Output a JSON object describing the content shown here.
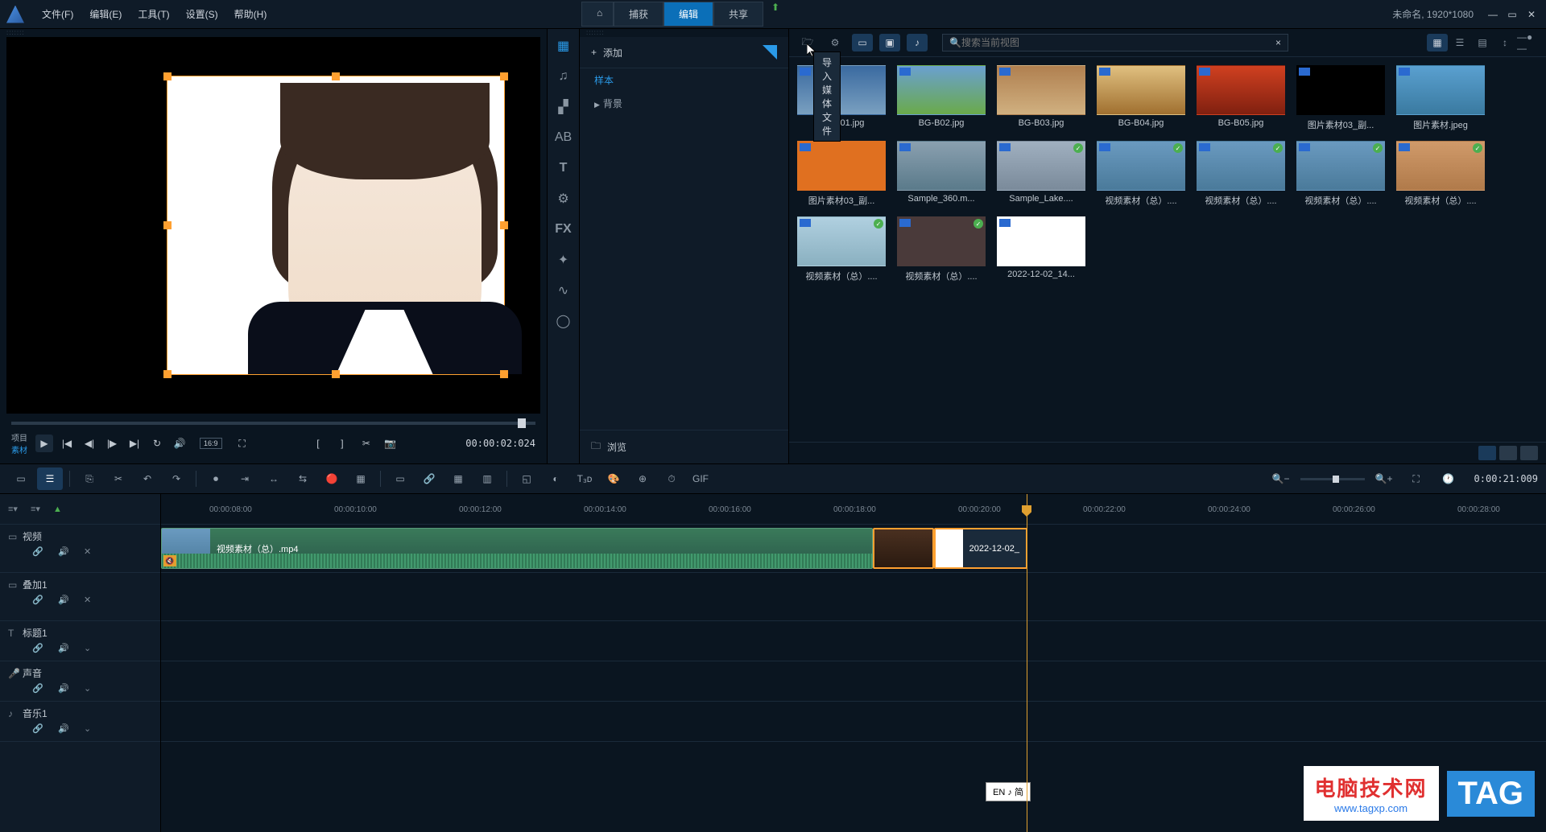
{
  "menu": {
    "file": "文件(F)",
    "edit": "编辑(E)",
    "tools": "工具(T)",
    "settings": "设置(S)",
    "help": "帮助(H)"
  },
  "modes": {
    "home": "⌂",
    "capture": "捕获",
    "edit": "编辑",
    "share": "共享"
  },
  "project_info": "未命名, 1920*1080",
  "preview": {
    "label_project": "项目",
    "label_source": "素材",
    "timecode": "00:00:02:024",
    "aspect": "16:9"
  },
  "library": {
    "add_label": "添加",
    "cat_sample": "样本",
    "cat_background": "背景",
    "browse_label": "浏览",
    "search_placeholder": "搜索当前视图",
    "import_tooltip": "导入媒体文件"
  },
  "media": [
    {
      "name": "BG-B01.jpg",
      "bg": "linear-gradient(#3a6aa0,#7aa0c0)",
      "check": false
    },
    {
      "name": "BG-B02.jpg",
      "bg": "linear-gradient(#6aa0d0,#6aaa4a)",
      "check": false
    },
    {
      "name": "BG-B03.jpg",
      "bg": "linear-gradient(#b08050,#d0b080)",
      "check": false
    },
    {
      "name": "BG-B04.jpg",
      "bg": "linear-gradient(#e0c080,#a07030)",
      "check": false
    },
    {
      "name": "BG-B05.jpg",
      "bg": "linear-gradient(#d04020,#802010)",
      "check": false
    },
    {
      "name": "图片素材03_副...",
      "bg": "#000",
      "check": false
    },
    {
      "name": "图片素材.jpeg",
      "bg": "linear-gradient(#5aa0d0,#3a7aa0)",
      "check": false
    },
    {
      "name": "图片素材03_副...",
      "bg": "#e07020",
      "check": false
    },
    {
      "name": "Sample_360.m...",
      "bg": "linear-gradient(#8aa0b0,#5a7a8a)",
      "check": false
    },
    {
      "name": "Sample_Lake....",
      "bg": "linear-gradient(#a0b0c0,#7a8a9a)",
      "check": true
    },
    {
      "name": "视频素材（总）....",
      "bg": "linear-gradient(#6a9ac0,#4a7a9a)",
      "check": true
    },
    {
      "name": "视频素材（总）....",
      "bg": "linear-gradient(#6a9ac0,#4a7a9a)",
      "check": true
    },
    {
      "name": "视频素材（总）....",
      "bg": "linear-gradient(#6a9ac0,#4a7a9a)",
      "check": true
    },
    {
      "name": "视频素材（总）....",
      "bg": "linear-gradient(#d09a6a,#b07a4a)",
      "check": true
    },
    {
      "name": "视频素材（总）....",
      "bg": "linear-gradient(#b0d0e0,#8ab0c0)",
      "check": true
    },
    {
      "name": "视频素材（总）....",
      "bg": "#4a3a3a",
      "check": true
    },
    {
      "name": "2022-12-02_14...",
      "bg": "#fff",
      "check": false
    }
  ],
  "tracks": {
    "video": "视频",
    "overlay": "叠加1",
    "title": "标题1",
    "sound": "声音",
    "music": "音乐1"
  },
  "ruler_marks": [
    "00:00:08:00",
    "00:00:10:00",
    "00:00:12:00",
    "00:00:14:00",
    "00:00:16:00",
    "00:00:18:00",
    "00:00:20:00",
    "00:00:22:00",
    "00:00:24:00",
    "00:00:26:00",
    "00:00:28:00"
  ],
  "clips": {
    "main_video": "视频素材（总）.mp4",
    "photo_clip": "2022-12-02_"
  },
  "timeline_time": "0:00:21:009",
  "ime": "EN ♪ 简",
  "watermark": {
    "main": "电脑技术网",
    "sub": "www.tagxp.com",
    "tag": "TAG"
  }
}
